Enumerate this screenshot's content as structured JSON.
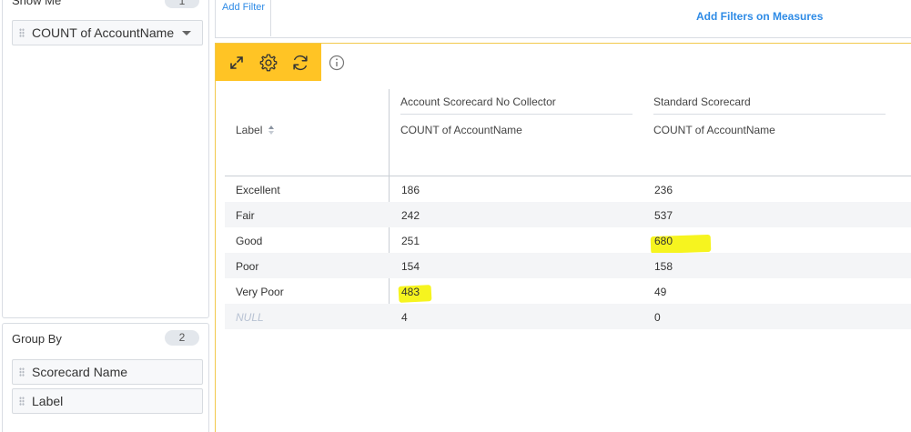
{
  "show_me": {
    "title": "Show Me",
    "count": "1",
    "measure": "COUNT of AccountName"
  },
  "group_by": {
    "title": "Group By",
    "count": "2",
    "fields": [
      "Scorecard Name",
      "Label"
    ]
  },
  "filters": {
    "add_filter": "Add Filter",
    "add_measure_filter": "Add Filters on Measures"
  },
  "toolbar": {
    "icons": [
      "expand-icon",
      "gear-icon",
      "refresh-icon",
      "info-icon"
    ]
  },
  "table": {
    "row_header": "Label",
    "groups": [
      {
        "name": "Account Scorecard No Collector",
        "measure": "COUNT of AccountName"
      },
      {
        "name": "Standard Scorecard",
        "measure": "COUNT of AccountName"
      }
    ],
    "rows": [
      {
        "label": "Excellent",
        "v1": "186",
        "v2": "236"
      },
      {
        "label": "Fair",
        "v1": "242",
        "v2": "537"
      },
      {
        "label": "Good",
        "v1": "251",
        "v2": "680"
      },
      {
        "label": "Poor",
        "v1": "154",
        "v2": "158"
      },
      {
        "label": "Very Poor",
        "v1": "483",
        "v2": "49"
      },
      {
        "label": "NULL",
        "v1": "4",
        "v2": "0"
      }
    ]
  },
  "colors": {
    "accent_blue": "#2e8be6",
    "toolbar_yellow": "#ffc425",
    "highlight": "#f6f313"
  }
}
